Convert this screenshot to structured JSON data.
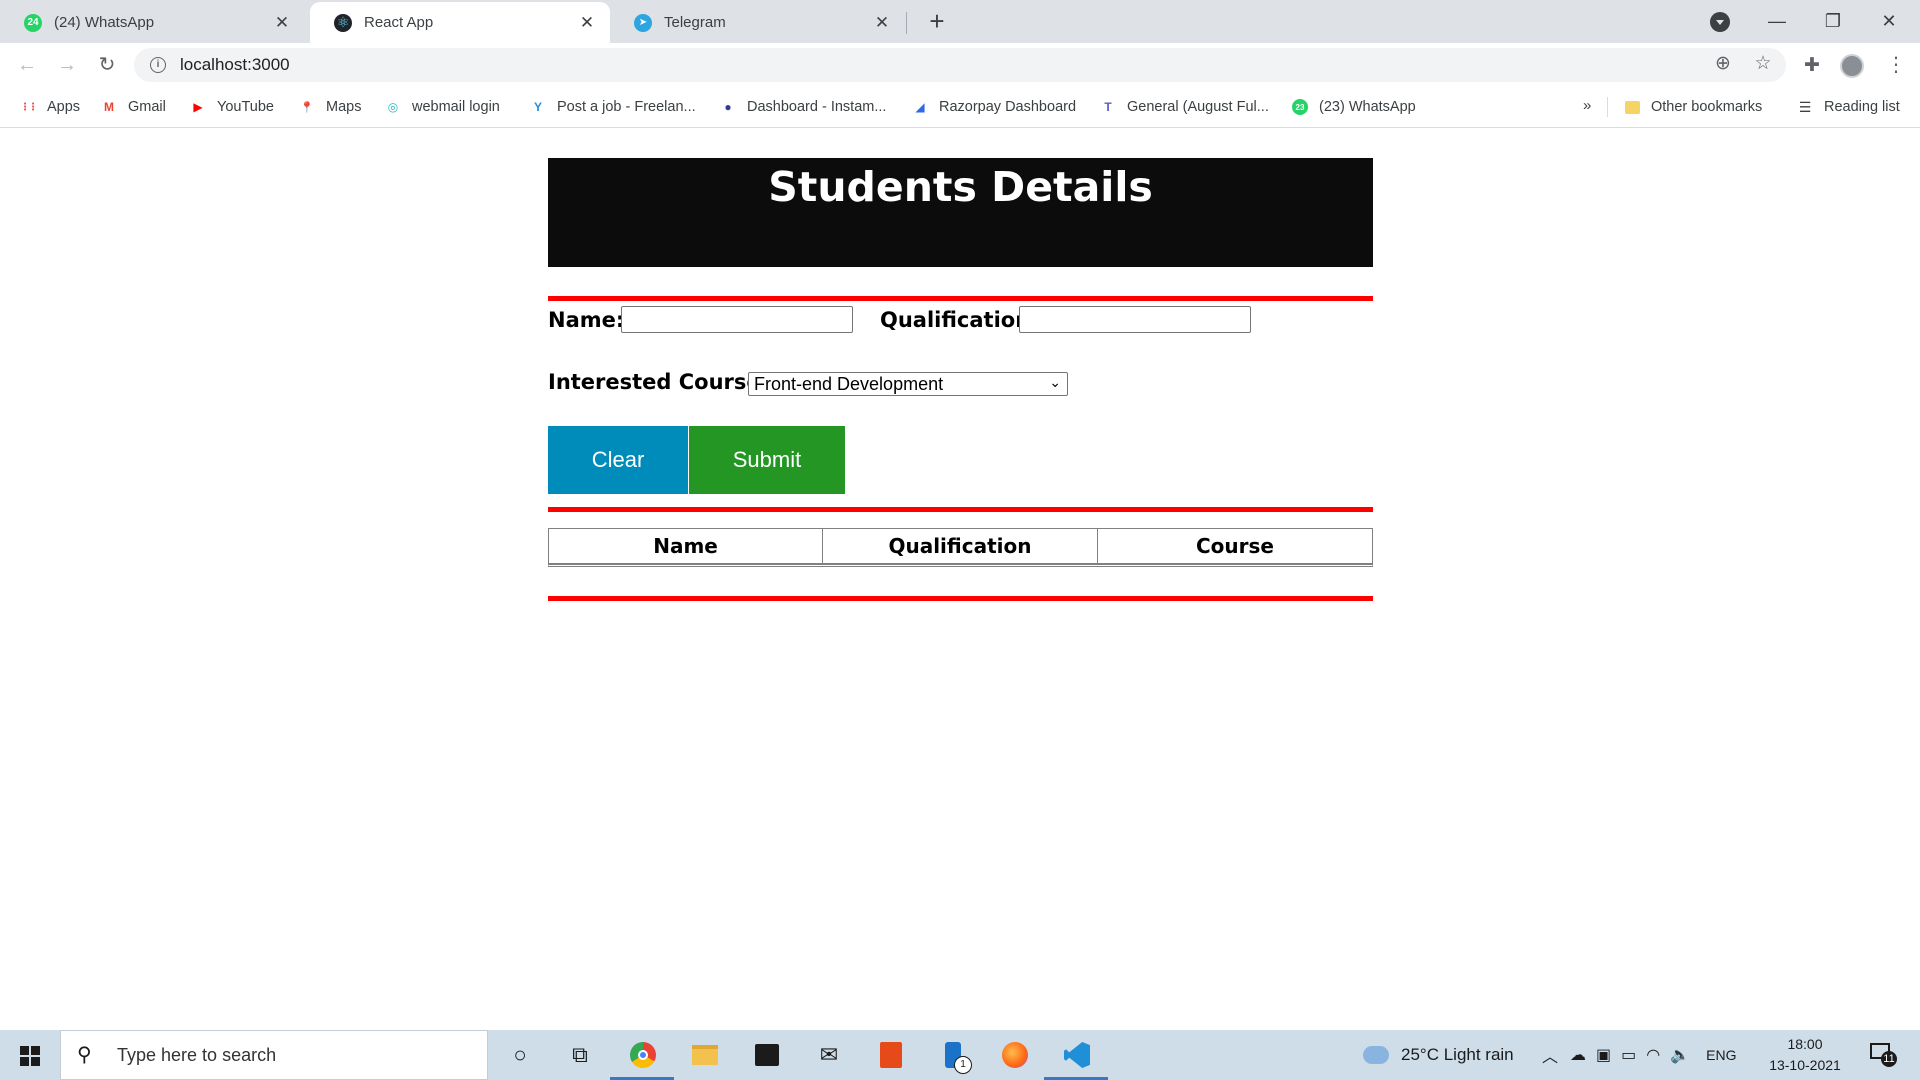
{
  "browser": {
    "tabs": [
      {
        "title": "(24) WhatsApp",
        "favicon_text": "24",
        "favicon_color": "#25d366",
        "active": false
      },
      {
        "title": "React App",
        "favicon_text": "⚛",
        "favicon_color": "#20232a",
        "active": true
      },
      {
        "title": "Telegram",
        "favicon_text": "➤",
        "favicon_color": "#2ca5e0",
        "active": false
      }
    ],
    "close_glyph": "✕",
    "new_tab_glyph": "+",
    "window_controls": {
      "minimize": "—",
      "restore": "❐",
      "close": "✕"
    },
    "url": "localhost:3000",
    "bookmarks": [
      {
        "label": "Apps",
        "icon": "apps-grid-icon",
        "glyph": "⋮⋮",
        "color": "#ea4335"
      },
      {
        "label": "Gmail",
        "icon": "gmail-icon",
        "glyph": "M",
        "color": "#ea4335"
      },
      {
        "label": "YouTube",
        "icon": "youtube-icon",
        "glyph": "▶",
        "color": "#ff0000"
      },
      {
        "label": "Maps",
        "icon": "maps-pin-icon",
        "glyph": "📍",
        "color": "#34a853"
      },
      {
        "label": "webmail login",
        "icon": "webmail-icon",
        "glyph": "◎",
        "color": "#22b8b8"
      },
      {
        "label": "Post a job - Freelan...",
        "icon": "freelancer-icon",
        "glyph": "Y",
        "color": "#1f8fd8"
      },
      {
        "label": "Dashboard - Instam...",
        "icon": "instamojo-icon",
        "glyph": "●",
        "color": "#3a3a8c"
      },
      {
        "label": "Razorpay Dashboard",
        "icon": "razorpay-icon",
        "glyph": "◢",
        "color": "#2d6ae3"
      },
      {
        "label": "General (August Ful...",
        "icon": "teams-icon",
        "glyph": "T",
        "color": "#5b5fc7"
      },
      {
        "label": "(23) WhatsApp",
        "icon": "whatsapp-icon",
        "glyph": "23",
        "color": "#25d366"
      }
    ],
    "bookmarks_overflow": "»",
    "other_bookmarks": "Other bookmarks",
    "reading_list": "Reading list"
  },
  "app": {
    "heading": "Students Details",
    "form": {
      "name_label": "Name:",
      "name_value": "",
      "qualification_label": "Qualification:",
      "qualification_value": "",
      "course_label": "Interested Course :",
      "course_selected": "Front-end Development",
      "clear_label": "Clear",
      "submit_label": "Submit"
    },
    "table": {
      "headers": [
        "Name",
        "Qualification",
        "Course"
      ],
      "rows": []
    },
    "colors": {
      "banner_bg": "#0c0c0c",
      "divider": "#ff0000",
      "clear_button": "#008cba",
      "submit_button": "#239623"
    }
  },
  "taskbar": {
    "search_placeholder": "Type here to search",
    "weather": "25°C  Light rain",
    "language": "ENG",
    "time": "18:00",
    "date": "13-10-2021",
    "notification_count": "11",
    "store_badge": "1"
  }
}
